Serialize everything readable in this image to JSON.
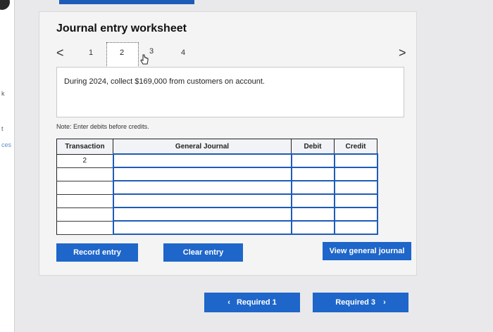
{
  "header": {
    "title": "Journal entry worksheet"
  },
  "steps": {
    "prev": "<",
    "next": ">",
    "items": [
      "1",
      "2",
      "3",
      "4"
    ],
    "current": "2"
  },
  "description": "During 2024, collect $169,000 from customers on account.",
  "note": "Note: Enter debits before credits.",
  "table": {
    "columns": [
      "Transaction",
      "General Journal",
      "Debit",
      "Credit"
    ],
    "rows": [
      {
        "transaction": "2",
        "account": "",
        "debit": "",
        "credit": ""
      },
      {
        "transaction": "",
        "account": "",
        "debit": "",
        "credit": ""
      },
      {
        "transaction": "",
        "account": "",
        "debit": "",
        "credit": ""
      },
      {
        "transaction": "",
        "account": "",
        "debit": "",
        "credit": ""
      },
      {
        "transaction": "",
        "account": "",
        "debit": "",
        "credit": ""
      },
      {
        "transaction": "",
        "account": "",
        "debit": "",
        "credit": ""
      }
    ]
  },
  "buttons": {
    "record": "Record entry",
    "clear": "Clear entry",
    "view": "View general journal",
    "prev_required": "Required 1",
    "next_required": "Required 3"
  },
  "left_labels": {
    "k": "k",
    "t": "t",
    "ces": "ces"
  },
  "colors": {
    "accent": "#1e66c9",
    "input_border": "#1e5bb8"
  }
}
